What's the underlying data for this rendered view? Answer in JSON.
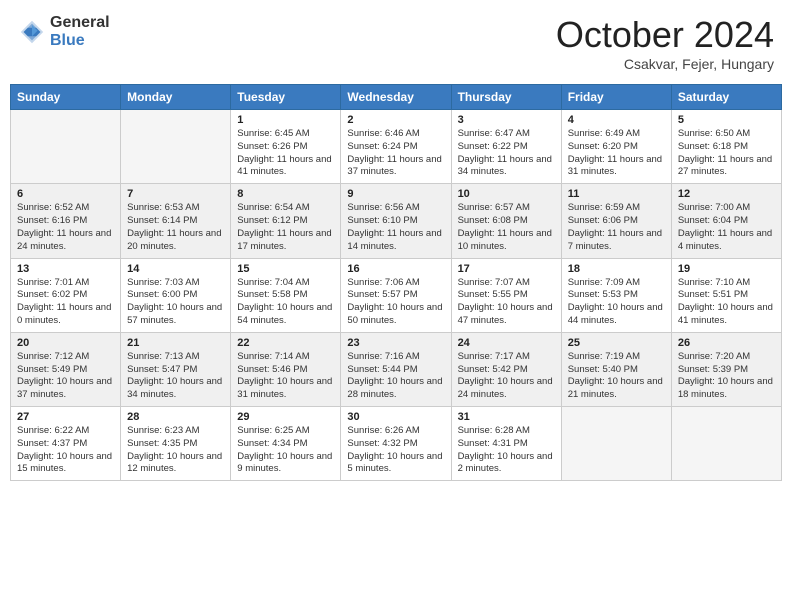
{
  "header": {
    "logo_general": "General",
    "logo_blue": "Blue",
    "month_title": "October 2024",
    "location": "Csakvar, Fejer, Hungary"
  },
  "days_of_week": [
    "Sunday",
    "Monday",
    "Tuesday",
    "Wednesday",
    "Thursday",
    "Friday",
    "Saturday"
  ],
  "weeks": [
    [
      {
        "day": "",
        "detail": ""
      },
      {
        "day": "",
        "detail": ""
      },
      {
        "day": "1",
        "detail": "Sunrise: 6:45 AM\nSunset: 6:26 PM\nDaylight: 11 hours and 41 minutes."
      },
      {
        "day": "2",
        "detail": "Sunrise: 6:46 AM\nSunset: 6:24 PM\nDaylight: 11 hours and 37 minutes."
      },
      {
        "day": "3",
        "detail": "Sunrise: 6:47 AM\nSunset: 6:22 PM\nDaylight: 11 hours and 34 minutes."
      },
      {
        "day": "4",
        "detail": "Sunrise: 6:49 AM\nSunset: 6:20 PM\nDaylight: 11 hours and 31 minutes."
      },
      {
        "day": "5",
        "detail": "Sunrise: 6:50 AM\nSunset: 6:18 PM\nDaylight: 11 hours and 27 minutes."
      }
    ],
    [
      {
        "day": "6",
        "detail": "Sunrise: 6:52 AM\nSunset: 6:16 PM\nDaylight: 11 hours and 24 minutes."
      },
      {
        "day": "7",
        "detail": "Sunrise: 6:53 AM\nSunset: 6:14 PM\nDaylight: 11 hours and 20 minutes."
      },
      {
        "day": "8",
        "detail": "Sunrise: 6:54 AM\nSunset: 6:12 PM\nDaylight: 11 hours and 17 minutes."
      },
      {
        "day": "9",
        "detail": "Sunrise: 6:56 AM\nSunset: 6:10 PM\nDaylight: 11 hours and 14 minutes."
      },
      {
        "day": "10",
        "detail": "Sunrise: 6:57 AM\nSunset: 6:08 PM\nDaylight: 11 hours and 10 minutes."
      },
      {
        "day": "11",
        "detail": "Sunrise: 6:59 AM\nSunset: 6:06 PM\nDaylight: 11 hours and 7 minutes."
      },
      {
        "day": "12",
        "detail": "Sunrise: 7:00 AM\nSunset: 6:04 PM\nDaylight: 11 hours and 4 minutes."
      }
    ],
    [
      {
        "day": "13",
        "detail": "Sunrise: 7:01 AM\nSunset: 6:02 PM\nDaylight: 11 hours and 0 minutes."
      },
      {
        "day": "14",
        "detail": "Sunrise: 7:03 AM\nSunset: 6:00 PM\nDaylight: 10 hours and 57 minutes."
      },
      {
        "day": "15",
        "detail": "Sunrise: 7:04 AM\nSunset: 5:58 PM\nDaylight: 10 hours and 54 minutes."
      },
      {
        "day": "16",
        "detail": "Sunrise: 7:06 AM\nSunset: 5:57 PM\nDaylight: 10 hours and 50 minutes."
      },
      {
        "day": "17",
        "detail": "Sunrise: 7:07 AM\nSunset: 5:55 PM\nDaylight: 10 hours and 47 minutes."
      },
      {
        "day": "18",
        "detail": "Sunrise: 7:09 AM\nSunset: 5:53 PM\nDaylight: 10 hours and 44 minutes."
      },
      {
        "day": "19",
        "detail": "Sunrise: 7:10 AM\nSunset: 5:51 PM\nDaylight: 10 hours and 41 minutes."
      }
    ],
    [
      {
        "day": "20",
        "detail": "Sunrise: 7:12 AM\nSunset: 5:49 PM\nDaylight: 10 hours and 37 minutes."
      },
      {
        "day": "21",
        "detail": "Sunrise: 7:13 AM\nSunset: 5:47 PM\nDaylight: 10 hours and 34 minutes."
      },
      {
        "day": "22",
        "detail": "Sunrise: 7:14 AM\nSunset: 5:46 PM\nDaylight: 10 hours and 31 minutes."
      },
      {
        "day": "23",
        "detail": "Sunrise: 7:16 AM\nSunset: 5:44 PM\nDaylight: 10 hours and 28 minutes."
      },
      {
        "day": "24",
        "detail": "Sunrise: 7:17 AM\nSunset: 5:42 PM\nDaylight: 10 hours and 24 minutes."
      },
      {
        "day": "25",
        "detail": "Sunrise: 7:19 AM\nSunset: 5:40 PM\nDaylight: 10 hours and 21 minutes."
      },
      {
        "day": "26",
        "detail": "Sunrise: 7:20 AM\nSunset: 5:39 PM\nDaylight: 10 hours and 18 minutes."
      }
    ],
    [
      {
        "day": "27",
        "detail": "Sunrise: 6:22 AM\nSunset: 4:37 PM\nDaylight: 10 hours and 15 minutes."
      },
      {
        "day": "28",
        "detail": "Sunrise: 6:23 AM\nSunset: 4:35 PM\nDaylight: 10 hours and 12 minutes."
      },
      {
        "day": "29",
        "detail": "Sunrise: 6:25 AM\nSunset: 4:34 PM\nDaylight: 10 hours and 9 minutes."
      },
      {
        "day": "30",
        "detail": "Sunrise: 6:26 AM\nSunset: 4:32 PM\nDaylight: 10 hours and 5 minutes."
      },
      {
        "day": "31",
        "detail": "Sunrise: 6:28 AM\nSunset: 4:31 PM\nDaylight: 10 hours and 2 minutes."
      },
      {
        "day": "",
        "detail": ""
      },
      {
        "day": "",
        "detail": ""
      }
    ]
  ]
}
